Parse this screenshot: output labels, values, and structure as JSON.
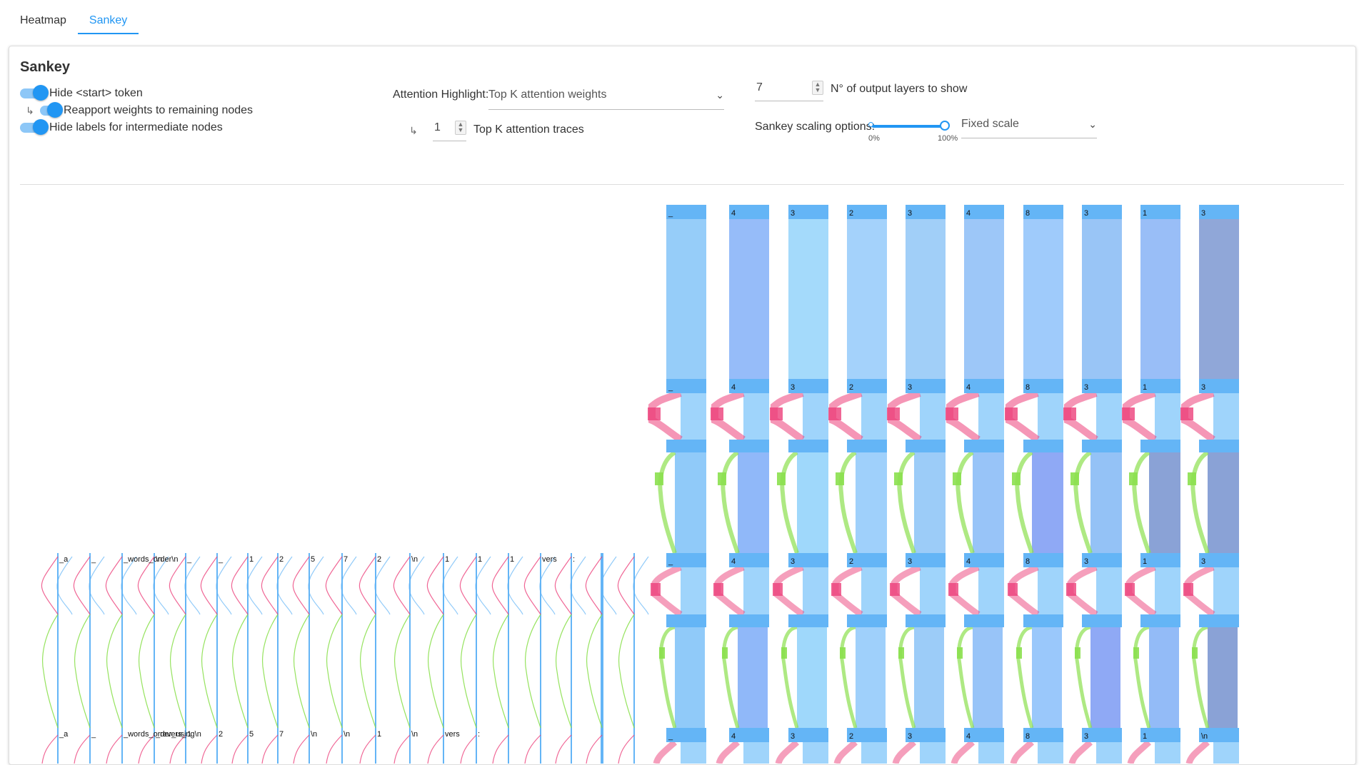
{
  "tabs": [
    {
      "label": "Heatmap",
      "active": false
    },
    {
      "label": "Sankey",
      "active": true
    }
  ],
  "card": {
    "title": "Sankey"
  },
  "options": {
    "hide_start": "Hide <start> token",
    "reapport": "Reapport weights to remaining nodes",
    "hide_labels": "Hide labels for intermediate nodes",
    "attention_highlight_label": "Attention Highlight:",
    "attention_highlight_value": "Top K attention weights",
    "top_k_value": "1",
    "top_k_label": "Top K attention traces",
    "layers_value": "7",
    "layers_label": "N° of output layers to show",
    "scaling_label": "Sankey scaling options:",
    "scaling_value": "Fixed scale",
    "slider_min": "0%",
    "slider_max": "100%",
    "slider_value_pct": 100
  },
  "colors": {
    "accent": "#2196f3",
    "node": "#64b5f6",
    "flow_light": "#90caf9",
    "attention_pink": "#ec407a",
    "attention_green": "#8be04e"
  },
  "sankey": {
    "output_tokens": [
      "_",
      "4",
      "3",
      "2",
      "3",
      "4",
      "8",
      "3",
      "1",
      "3"
    ],
    "last_row_output_tokens": [
      "_",
      "4",
      "3",
      "2",
      "3",
      "4",
      "8",
      "3",
      "1",
      "\\n"
    ],
    "input_tokens_row1": [
      "_a",
      "_",
      "_words_order\\n",
      "\\n",
      "_",
      "_",
      "1",
      "2",
      "5",
      "7",
      "2",
      "\\n",
      "1",
      "1",
      "1",
      "vers",
      ":"
    ],
    "input_tokens_row2": [
      "_a",
      "_",
      "_words_order_using\\n",
      "_revers_",
      "1",
      "2",
      "5",
      "7",
      "\\n",
      "\\n",
      "1",
      "\\n",
      "vers",
      ":"
    ]
  }
}
